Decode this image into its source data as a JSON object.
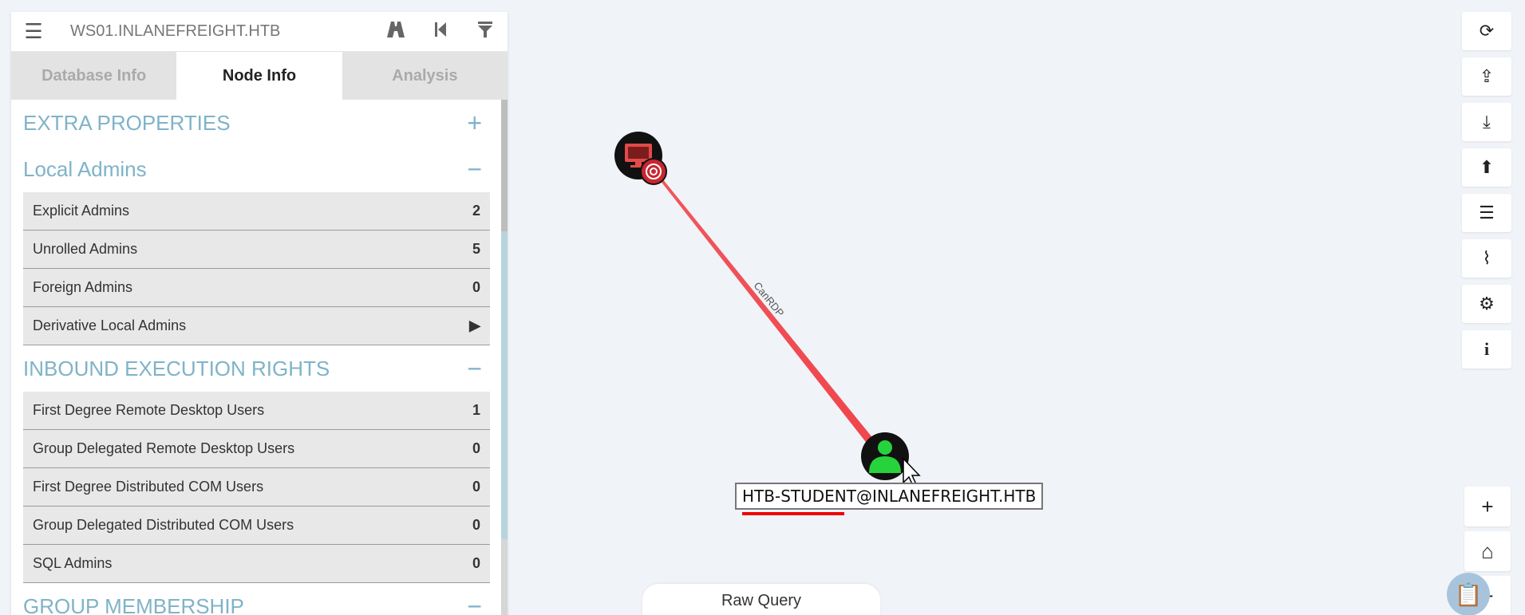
{
  "header": {
    "menu_icon": "hamburger-icon",
    "search_value": "WS01.INLANEFREIGHT.HTB",
    "icons": [
      "pathfinding-icon",
      "back-icon",
      "filter-icon"
    ]
  },
  "tabs": [
    {
      "label": "Database Info",
      "active": false
    },
    {
      "label": "Node Info",
      "active": true
    },
    {
      "label": "Analysis",
      "active": false
    }
  ],
  "sections": {
    "extra_properties": {
      "title": "EXTRA PROPERTIES",
      "toggle": "+"
    },
    "local_admins": {
      "title": "Local Admins",
      "toggle": "−",
      "rows": [
        {
          "label": "Explicit Admins",
          "value": "2"
        },
        {
          "label": "Unrolled Admins",
          "value": "5"
        },
        {
          "label": "Foreign Admins",
          "value": "0"
        },
        {
          "label": "Derivative Local Admins",
          "value": "▶"
        }
      ]
    },
    "inbound_execution": {
      "title": "INBOUND EXECUTION RIGHTS",
      "toggle": "−",
      "rows": [
        {
          "label": "First Degree Remote Desktop Users",
          "value": "1"
        },
        {
          "label": "Group Delegated Remote Desktop Users",
          "value": "0"
        },
        {
          "label": "First Degree Distributed COM Users",
          "value": "0"
        },
        {
          "label": "Group Delegated Distributed COM Users",
          "value": "0"
        },
        {
          "label": "SQL Admins",
          "value": "0"
        }
      ]
    },
    "group_membership": {
      "title": "GROUP MEMBERSHIP",
      "toggle": "−"
    }
  },
  "graph": {
    "edge_label": "CanRDP",
    "user_node_label": "HTB-STUDENT@INLANEFREIGHT.HTB",
    "edge_color": "#f0454c"
  },
  "toolbar": {
    "buttons": [
      "refresh-icon",
      "upload-icon",
      "download-icon",
      "upload-circle-icon",
      "checklist-icon",
      "chart-icon",
      "settings-icon",
      "info-icon"
    ],
    "glyphs": [
      "⟳",
      "⇪",
      "⤓",
      "⬆",
      "☰",
      "⌇",
      "⚙",
      "i"
    ]
  },
  "zoom": {
    "plus": "+",
    "home": "⌂",
    "minus": "−"
  },
  "raw_query": "Raw Query"
}
